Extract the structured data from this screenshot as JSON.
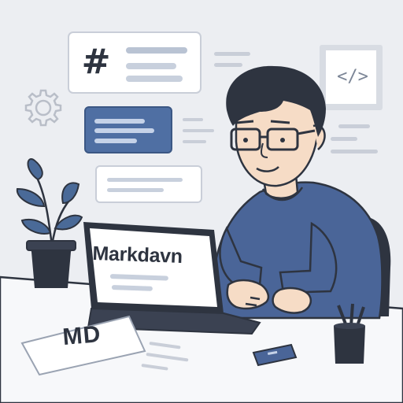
{
  "laptop": {
    "screen_title": "Markdavn"
  },
  "heading_card": {
    "symbol": "#"
  },
  "code_card": {
    "symbol": "</>"
  },
  "md_paper": {
    "text": "MD"
  },
  "colors": {
    "background": "#eceef2",
    "accent_blue": "#4f6fa3",
    "sweater_blue": "#4a6598",
    "outline": "#2e3440",
    "desk": "#f7f8fa",
    "skin": "#f6dcc6",
    "hair": "#2e3440",
    "plant": "#4a6a98",
    "pot": "#2e3440"
  },
  "icons": [
    "gear-icon",
    "code-icon",
    "hash-icon",
    "plant-icon",
    "pen-cup-icon",
    "card-icon"
  ]
}
